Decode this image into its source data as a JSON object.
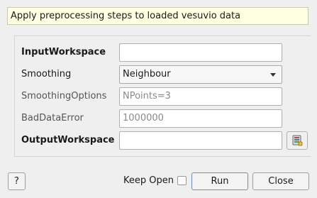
{
  "description": "Apply preprocessing steps to loaded vesuvio data",
  "properties": [
    {
      "label": "InputWorkspace",
      "value": "",
      "placeholder": "",
      "required": true,
      "kind": "text"
    },
    {
      "label": "Smoothing",
      "value": "Neighbour",
      "placeholder": "",
      "required": false,
      "kind": "select"
    },
    {
      "label": "SmoothingOptions",
      "value": "",
      "placeholder": "NPoints=3",
      "required": false,
      "kind": "text"
    },
    {
      "label": "BadDataError",
      "value": "",
      "placeholder": "1000000",
      "required": false,
      "kind": "text"
    },
    {
      "label": "OutputWorkspace",
      "value": "",
      "placeholder": "",
      "required": true,
      "kind": "text"
    }
  ],
  "footer": {
    "help_label": "?",
    "keep_open_label": "Keep Open",
    "keep_open_checked": false,
    "run_label": "Run",
    "close_label": "Close"
  },
  "icons": {
    "browse": "workspace-selector-icon"
  },
  "colors": {
    "description_bg": "#ffffe1",
    "primary_border": "#6d8fb8"
  }
}
